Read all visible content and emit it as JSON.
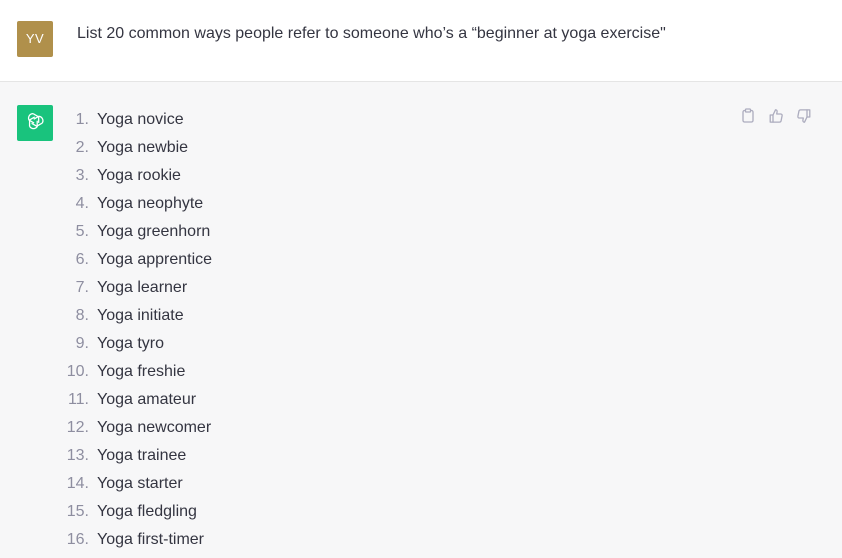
{
  "user": {
    "avatar_initials": "YV",
    "avatar_color": "#b0904b",
    "message": "List 20 common ways people refer to someone who’s a “beginner at yoga exercise\""
  },
  "assistant": {
    "avatar_icon": "openai-logo-icon",
    "avatar_color": "#19c37d",
    "items": [
      {
        "num": "1.",
        "text": "Yoga novice"
      },
      {
        "num": "2.",
        "text": "Yoga newbie"
      },
      {
        "num": "3.",
        "text": "Yoga rookie"
      },
      {
        "num": "4.",
        "text": "Yoga neophyte"
      },
      {
        "num": "5.",
        "text": "Yoga greenhorn"
      },
      {
        "num": "6.",
        "text": "Yoga apprentice"
      },
      {
        "num": "7.",
        "text": "Yoga learner"
      },
      {
        "num": "8.",
        "text": "Yoga initiate"
      },
      {
        "num": "9.",
        "text": "Yoga tyro"
      },
      {
        "num": "10.",
        "text": "Yoga freshie"
      },
      {
        "num": "11.",
        "text": "Yoga amateur"
      },
      {
        "num": "12.",
        "text": "Yoga newcomer"
      },
      {
        "num": "13.",
        "text": "Yoga trainee"
      },
      {
        "num": "14.",
        "text": "Yoga starter"
      },
      {
        "num": "15.",
        "text": "Yoga fledgling"
      },
      {
        "num": "16.",
        "text": "Yoga first-timer"
      }
    ],
    "actions": [
      "clipboard-icon",
      "thumbs-up-icon",
      "thumbs-down-icon"
    ]
  }
}
